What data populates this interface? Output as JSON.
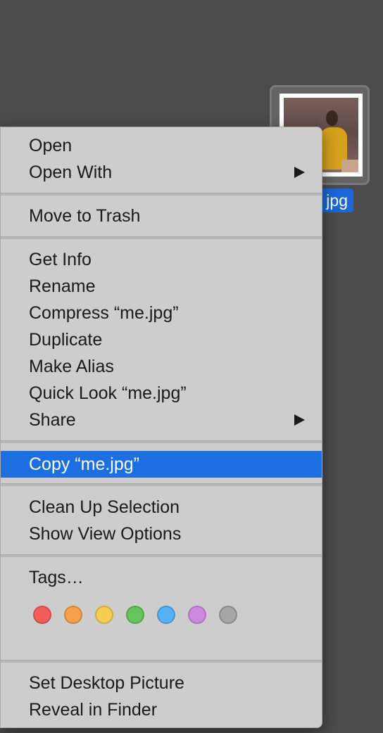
{
  "desktop": {
    "file": {
      "label_visible": "jpg"
    }
  },
  "context_menu": {
    "items": [
      {
        "label": "Open"
      },
      {
        "label": "Open With"
      },
      {
        "label": "Move to Trash"
      },
      {
        "label": "Get Info"
      },
      {
        "label": "Rename"
      },
      {
        "label": "Compress “me.jpg”"
      },
      {
        "label": "Duplicate"
      },
      {
        "label": "Make Alias"
      },
      {
        "label": "Quick Look “me.jpg”"
      },
      {
        "label": "Share"
      },
      {
        "label": "Copy “me.jpg”"
      },
      {
        "label": "Clean Up Selection"
      },
      {
        "label": "Show View Options"
      },
      {
        "label": "Tags…"
      },
      {
        "label": "Set Desktop Picture"
      },
      {
        "label": "Reveal in Finder"
      }
    ],
    "tag_colors": [
      {
        "name": "red",
        "color": "#f45c5c"
      },
      {
        "name": "orange",
        "color": "#f6a04a"
      },
      {
        "name": "yellow",
        "color": "#f5cd50"
      },
      {
        "name": "green",
        "color": "#65c45b"
      },
      {
        "name": "blue",
        "color": "#55b3f3"
      },
      {
        "name": "purple",
        "color": "#cf8ae0"
      },
      {
        "name": "gray",
        "color": "#a6a6a6"
      }
    ],
    "highlight_color": "#1b6fe0"
  }
}
